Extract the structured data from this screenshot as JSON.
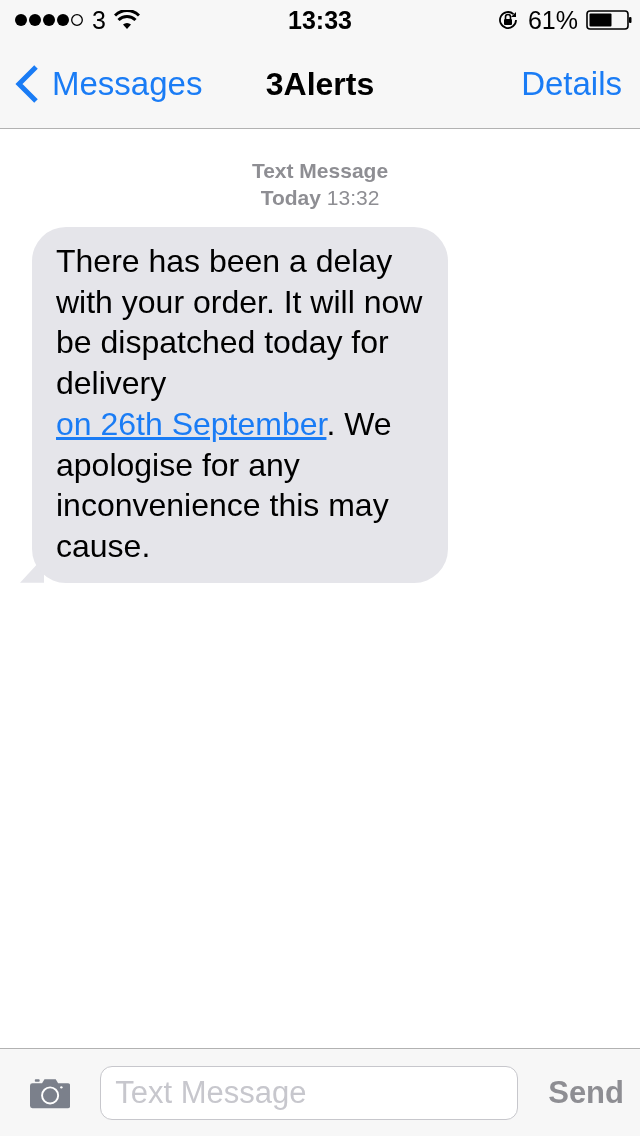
{
  "status_bar": {
    "carrier": "3",
    "time": "13:33",
    "battery_percent": "61%"
  },
  "nav_bar": {
    "back_label": "Messages",
    "title": "3Alerts",
    "action": "Details"
  },
  "conversation": {
    "service": "Text Message",
    "timestamp": "**Today** 13:32",
    "messages": [
      {
        "kind": "incoming",
        "text_before": "There has been a delay with your order. It will now be dispatched today for delivery",
        "link": "on 26th September",
        "text_after": ". We apologise for any inconvenience this may cause."
      }
    ]
  },
  "compose_bar": {
    "placeholder": "Text Message",
    "send_label": "Send",
    "send_disabled": true
  }
}
